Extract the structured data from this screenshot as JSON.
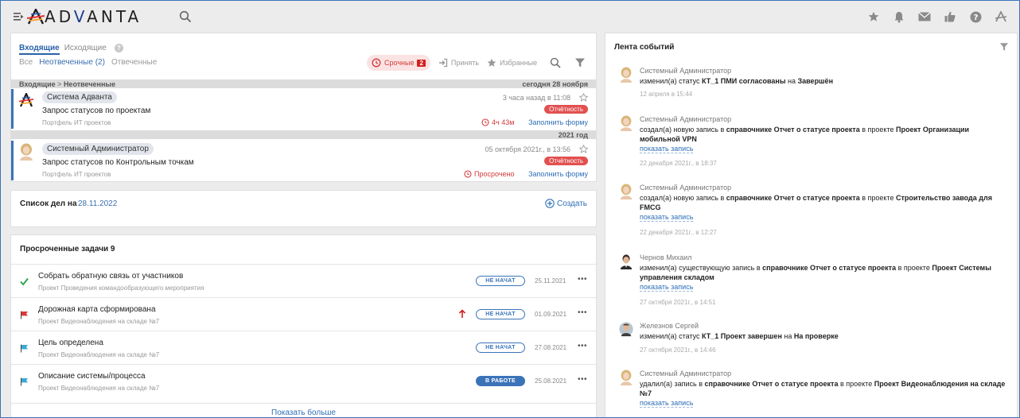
{
  "header": {
    "logo": "ADVANTA",
    "icons": [
      "menu-icon",
      "search-icon",
      "star-icon",
      "bell-icon",
      "mail-icon",
      "thumb-icon",
      "help-icon",
      "user-icon"
    ]
  },
  "inbox": {
    "tab_incoming": "Входящие",
    "tab_outgoing": "Исходящие",
    "help": "?",
    "sub_all": "Все",
    "sub_unanswered": "Неотвеченные (2)",
    "sub_answered": "Отвеченные",
    "urgent_label": "Срочные",
    "urgent_count": "2",
    "accept_label": "Принять",
    "favorites_label": "Избранные",
    "breadcrumb": "Входящие",
    "breadcrumb_sep": ">",
    "breadcrumb_current": "Неотвеченные",
    "group1_date": "сегодня 28 ноября",
    "group2_date": "2021 год",
    "messages": [
      {
        "sender": "Система Адванта",
        "title": "Запрос статусов по проектам",
        "sub": "Портфель ИТ проектов",
        "time": "3 часа назад в 11:08",
        "badge": "Отчётность",
        "due": "4ч 43м",
        "link": "Заполнить форму"
      },
      {
        "sender": "Системный Администратор",
        "title": "Запрос статусов по Контрольным точкам",
        "sub": "Портфель ИТ проектов",
        "time": "05 октября 2021г., в 13:56",
        "badge": "Отчётность",
        "due": "Просрочено",
        "link": "Заполнить форму"
      }
    ]
  },
  "todo": {
    "label": "Список дел на",
    "date": "28.11.2022",
    "create": "Создать"
  },
  "tasks": {
    "heading": "Просроченные задачи 9",
    "items": [
      {
        "title": "Собрать обратную связь от участников",
        "sub": "Проект Проведения командообразующего мероприятия",
        "status": "НЕ НАЧАТ",
        "date": "25.11.2021",
        "icon": "check-icon"
      },
      {
        "title": "Дорожная карта сформирована",
        "sub": "Проект Видеонаблюдения на складе №7",
        "status": "НЕ НАЧАТ",
        "date": "01.09.2021",
        "icon": "red-flag-icon"
      },
      {
        "title": "Цель определена",
        "sub": "Проект Видеонаблюдения на складе №7",
        "status": "НЕ НАЧАТ",
        "date": "27.08.2021",
        "icon": "blue-flag-icon"
      },
      {
        "title": "Описание системы/процесса",
        "sub": "Проект Видеонаблюдения на складе №7",
        "status": "В РАБОТЕ",
        "date": "25.08.2021",
        "icon": "blue-flag-icon"
      }
    ],
    "dots": "•••",
    "show_more": "Показать больше"
  },
  "feed": {
    "title": "Лента событий",
    "events": [
      {
        "author": "Системный Администратор",
        "t1": "изменил(а) статус ",
        "b1": "КТ_1 ПМИ согласованы",
        "t2": " на ",
        "b2": "Завершён",
        "t3": "",
        "b3": "",
        "link": "",
        "time": "12 апреля в 15:44"
      },
      {
        "author": "Системный Администратор",
        "t1": "создал(а) новую запись в ",
        "b1": "справочнике Отчет о статусе проекта",
        "t2": " в проекте ",
        "b2": "Проект Организации мобильной VPN",
        "t3": "",
        "b3": "",
        "link": "показать запись",
        "time": "22 декабря 2021г., в 18:37"
      },
      {
        "author": "Системный Администратор",
        "t1": "создал(а) новую запись в ",
        "b1": "справочнике Отчет о статусе проекта",
        "t2": " в проекте ",
        "b2": "Строительство завода для FMCG",
        "t3": "",
        "b3": "",
        "link": "показать запись",
        "time": "22 декабря 2021г., в 12:27"
      },
      {
        "author": "Чернов Михаил",
        "t1": "изменил(а) существующую запись в ",
        "b1": "справочнике Отчет о статусе проекта",
        "t2": " в проекте ",
        "b2": "Проект Системы управления складом",
        "t3": "",
        "b3": "",
        "link": "показать запись",
        "time": "27 октября 2021г., в 14:51"
      },
      {
        "author": "Железнов Сергей",
        "t1": "изменил(а) статус ",
        "b1": "КТ_1 Проект завершен",
        "t2": " на ",
        "b2": "На проверке",
        "t3": "",
        "b3": "",
        "link": "",
        "time": "27 октября 2021г., в 14:46"
      },
      {
        "author": "Системный Администратор",
        "t1": "удалил(а) запись в ",
        "b1": "справочнике Отчет о статусе проекта",
        "t2": " в проекте ",
        "b2": "Проект Видеонаблюдения на складе №7",
        "t3": "",
        "b3": "",
        "link": "показать запись",
        "time": ""
      }
    ]
  },
  "colors": {
    "accent": "#3b73b9",
    "urgent": "#d41f1f",
    "badge": "#e25050",
    "background": "#ececec"
  }
}
